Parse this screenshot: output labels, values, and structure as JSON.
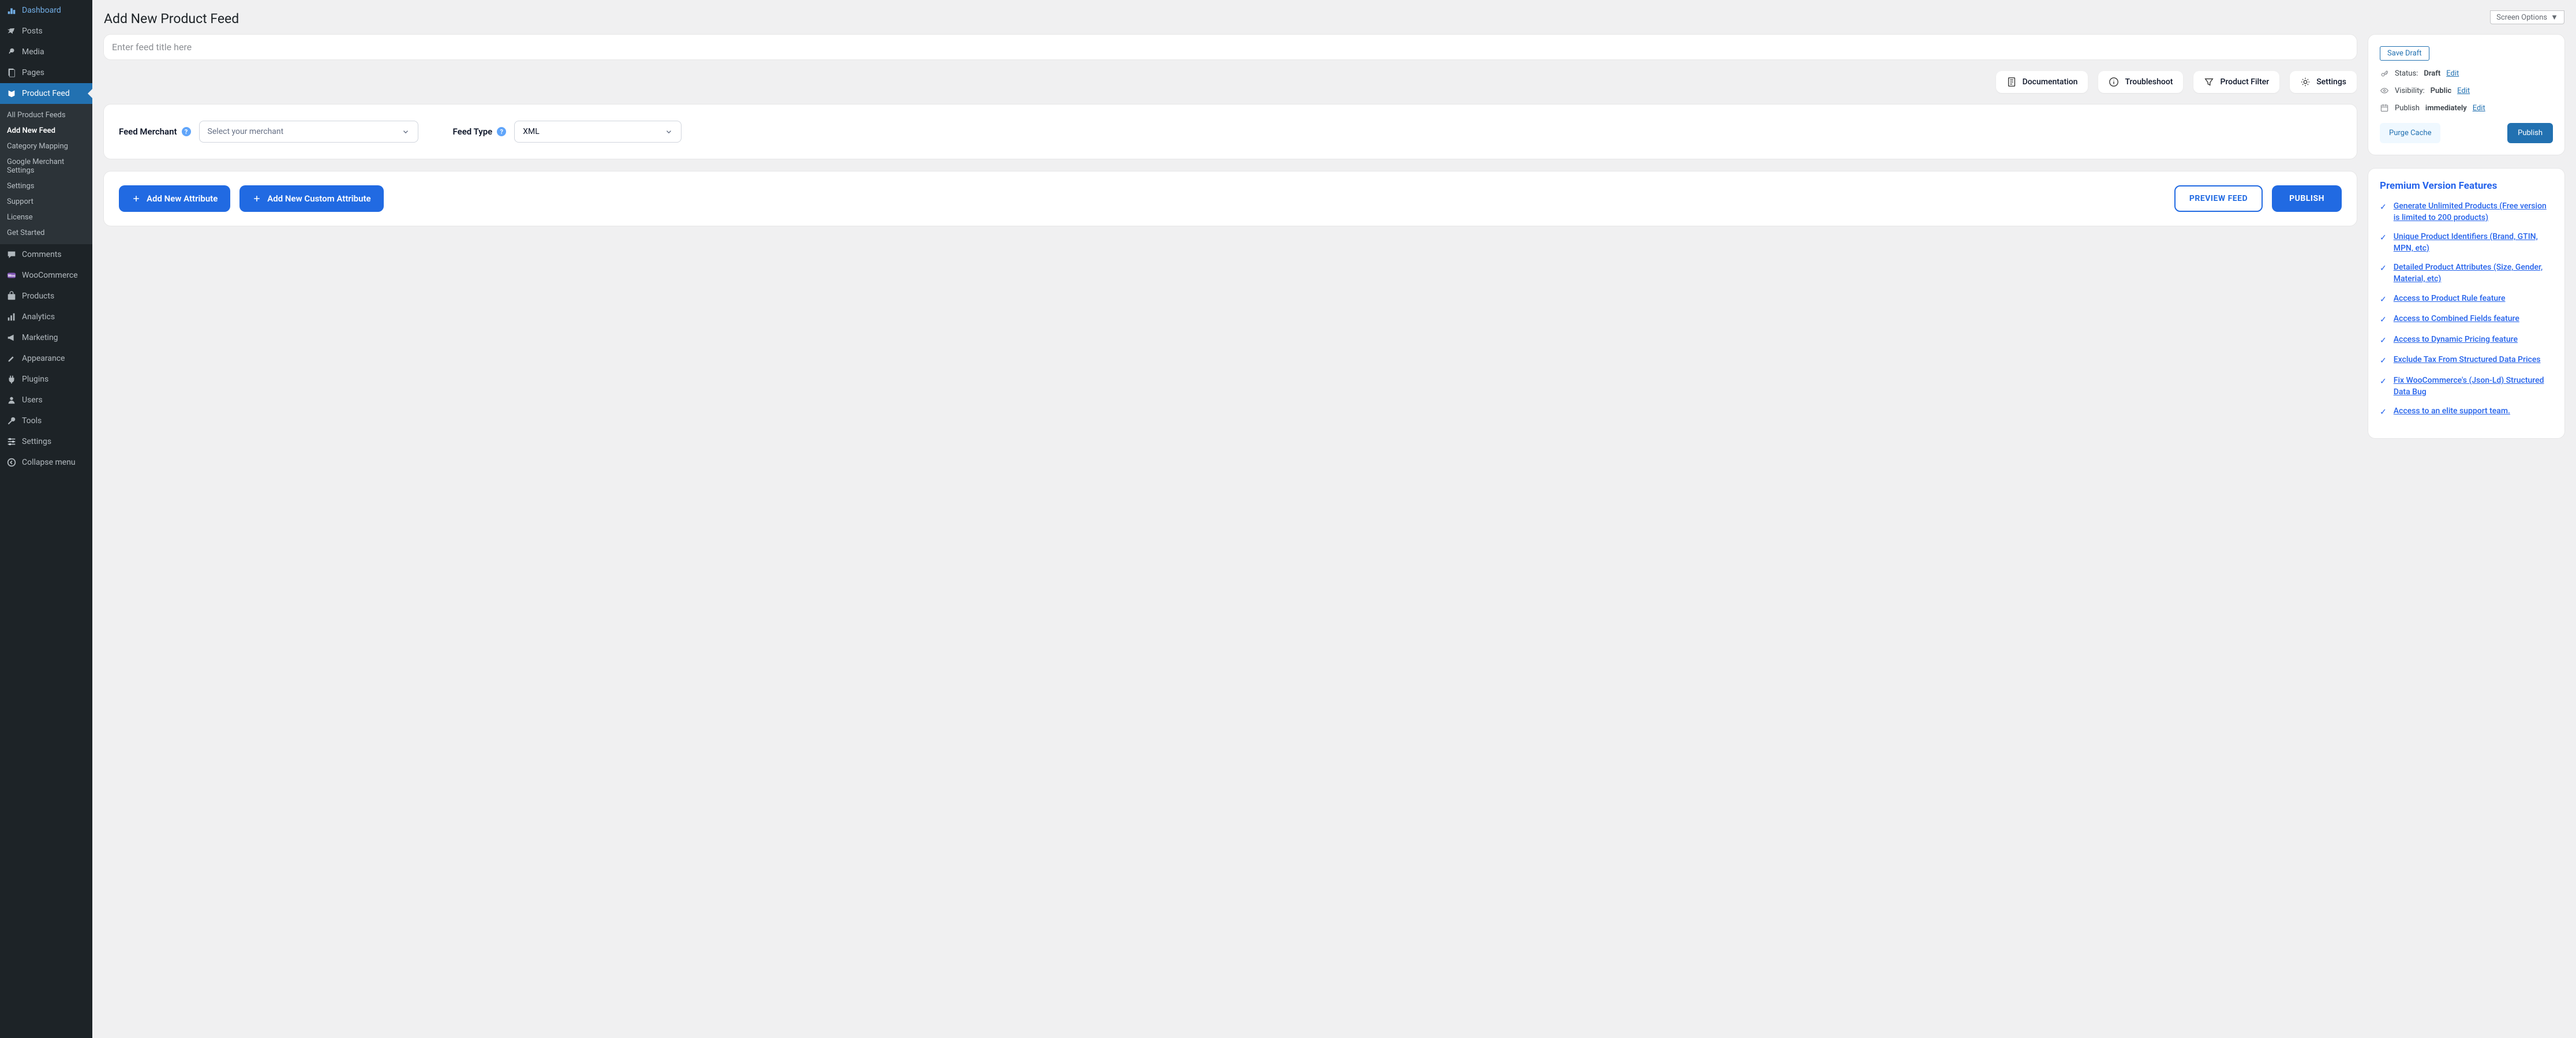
{
  "header": {
    "title": "Add New Product Feed",
    "screen_options": "Screen Options"
  },
  "sidebar": {
    "items": [
      {
        "label": "Dashboard",
        "icon": "dashboard"
      },
      {
        "label": "Posts",
        "icon": "pin"
      },
      {
        "label": "Media",
        "icon": "media"
      },
      {
        "label": "Pages",
        "icon": "page"
      },
      {
        "label": "Product Feed",
        "icon": "feed",
        "active": true
      },
      {
        "label": "Comments",
        "icon": "comment"
      },
      {
        "label": "WooCommerce",
        "icon": "woo"
      },
      {
        "label": "Products",
        "icon": "product"
      },
      {
        "label": "Analytics",
        "icon": "analytics"
      },
      {
        "label": "Marketing",
        "icon": "marketing"
      },
      {
        "label": "Appearance",
        "icon": "appearance"
      },
      {
        "label": "Plugins",
        "icon": "plugin"
      },
      {
        "label": "Users",
        "icon": "user"
      },
      {
        "label": "Tools",
        "icon": "tool"
      },
      {
        "label": "Settings",
        "icon": "settings"
      },
      {
        "label": "Collapse menu",
        "icon": "collapse"
      }
    ],
    "submenu": [
      "All Product Feeds",
      "Add New Feed",
      "Category Mapping",
      "Google Merchant Settings",
      "Settings",
      "Support",
      "License",
      "Get Started"
    ],
    "submenu_active_index": 1
  },
  "title_input": {
    "placeholder": "Enter feed title here"
  },
  "toolbar": {
    "documentation": "Documentation",
    "troubleshoot": "Troubleshoot",
    "product_filter": "Product Filter",
    "settings": "Settings"
  },
  "form": {
    "merchant_label": "Feed Merchant",
    "merchant_placeholder": "Select your merchant",
    "type_label": "Feed Type",
    "type_value": "XML"
  },
  "actions": {
    "add_attribute": "Add New Attribute",
    "add_custom_attribute": "Add New Custom Attribute",
    "preview": "PREVIEW FEED",
    "publish": "PUBLISH"
  },
  "publish_box": {
    "save_draft": "Save Draft",
    "status_label": "Status:",
    "status_value": "Draft",
    "visibility_label": "Visibility:",
    "visibility_value": "Public",
    "publish_label": "Publish",
    "publish_value": "immediately",
    "edit": "Edit",
    "purge_cache": "Purge Cache",
    "publish_btn": "Publish"
  },
  "premium": {
    "title": "Premium Version Features",
    "features": [
      "Generate Unlimited Products (Free version is limited to 200 products)",
      "Unique Product Identifiers (Brand, GTIN, MPN, etc)",
      "Detailed Product Attributes (Size, Gender, Material, etc)",
      "Access to Product Rule feature",
      "Access to Combined Fields feature",
      "Access to Dynamic Pricing feature",
      "Exclude Tax From Structured Data Prices",
      "Fix WooCommerce's (Json-Ld) Structured Data Bug",
      "Access to an elite support team."
    ]
  }
}
